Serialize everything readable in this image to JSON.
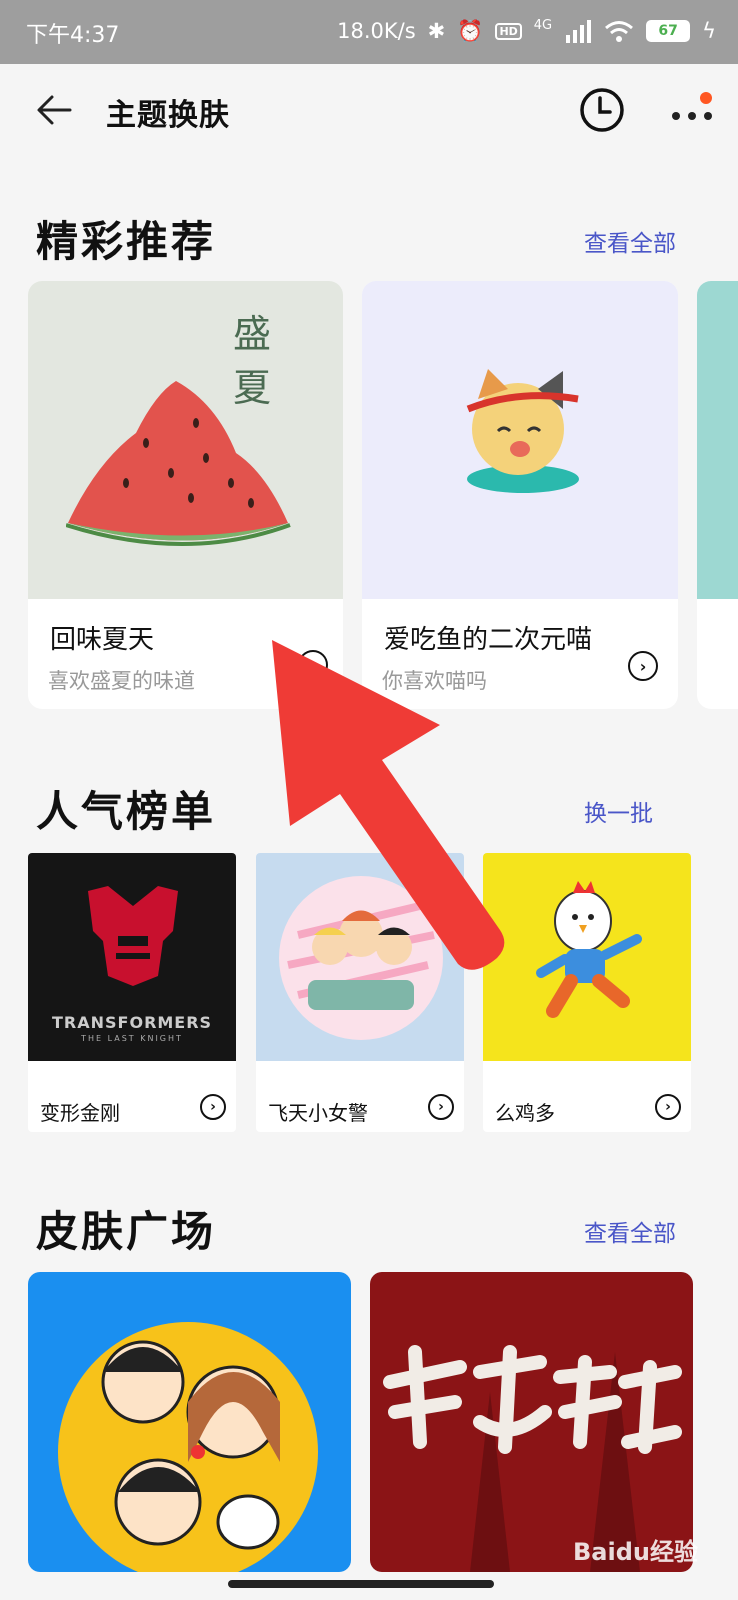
{
  "status_bar": {
    "time": "下午4:37",
    "speed": "18.0K/s",
    "network": "4G",
    "hd": "HD",
    "battery": "67"
  },
  "header": {
    "title": "主题换肤"
  },
  "featured": {
    "title": "精彩推荐",
    "link": "查看全部",
    "cards": [
      {
        "title": "回味夏天",
        "subtitle": "喜欢盛夏的味道",
        "art_text": "盛\n夏"
      },
      {
        "title": "爱吃鱼的二次元喵",
        "subtitle": "你喜欢喵吗"
      }
    ]
  },
  "popular": {
    "title": "人气榜单",
    "link": "换一批",
    "items": [
      {
        "title": "变形金刚",
        "art_text": "TRANSFORMERS",
        "art_sub": "THE LAST KNIGHT"
      },
      {
        "title": "飞天小女警"
      },
      {
        "title": "么鸡多"
      }
    ]
  },
  "plaza": {
    "title": "皮肤广场",
    "link": "查看全部",
    "cards": [
      {
        "art": "cartoon-family"
      },
      {
        "art": "calligraphy"
      }
    ]
  },
  "watermark": "Baidu经验",
  "colors": {
    "accent": "#4a56c8",
    "arrow": "#ef3b36",
    "status_bar": "#9e9e9e"
  }
}
